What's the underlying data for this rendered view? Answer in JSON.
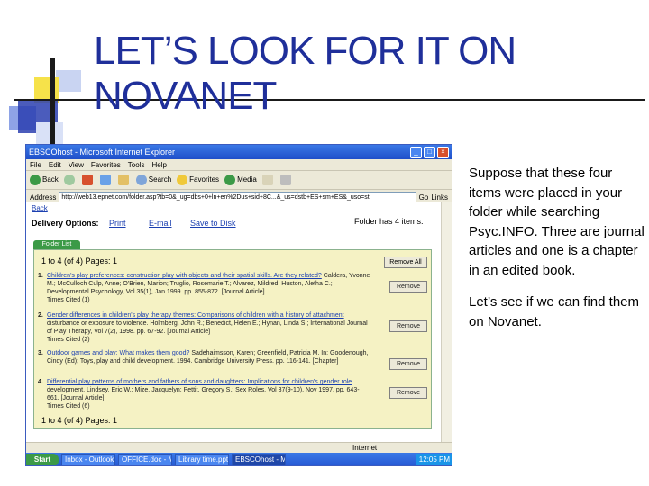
{
  "slide": {
    "title_line1": "LET’S LOOK FOR IT ON",
    "title_line2": "NOVANET",
    "note1": "Suppose that these four items were placed in your folder while searching Psyc.INFO. Three are journal articles and one is a chapter in an edited book.",
    "note2": "Let’s see if we can find them on Novanet."
  },
  "browser": {
    "title": "EBSCOhost - Microsoft Internet Explorer",
    "menu": [
      "File",
      "Edit",
      "View",
      "Favorites",
      "Tools",
      "Help"
    ],
    "toolbar": [
      "Back",
      "Search",
      "Favorites",
      "Media"
    ],
    "address_label": "Address",
    "address_value": "http://web13.epnet.com/folder.asp?tb=0&_ug=dbs+0+ln+en%2Dus+sid+8C...&_us=dstb+ES+sm+ES&_uso=st",
    "go_label": "Go",
    "links_label": "Links",
    "status_zone": "Internet"
  },
  "page": {
    "back_label": "Back",
    "delivery_label": "Delivery Options:",
    "print_label": "Print",
    "email_label": "E-mail",
    "save_label": "Save to Disk",
    "folder_count": "Folder has 4 items.",
    "tab_label": "Folder List",
    "pager_top": "1 to 4 (of 4)   Pages: 1",
    "pager_bottom": "1 to 4 (of 4)   Pages: 1",
    "remove_all": "Remove All",
    "remove": "Remove",
    "items": [
      {
        "num": "1.",
        "title": "Children's play preferences: construction play with objects and their spatial skills. Are they related?",
        "body": "Caldera, Yvonne M.; McCulloch Culp, Anne; O'Brien, Marion; Truglio, Rosemarie T.; Alvarez, Mildred; Huston, Aletha C.; Developmental Psychology, Vol 35(1), Jan 1999. pp. 855-872. [Journal Article]",
        "cited": "Times Cited (1)"
      },
      {
        "num": "2.",
        "title": "Gender differences in children's play therapy themes: Comparisons of children with a history of attachment",
        "body": "disturbance or exposure to violence. Holmberg, John R.; Benedict, Helen E.; Hynan, Linda S.; International Journal of Play Therapy, Vol 7(2), 1998. pp. 67-92. [Journal Article]",
        "cited": "Times Cited (2)"
      },
      {
        "num": "3.",
        "title": "Outdoor games and play: What makes them good?",
        "body": "Sadehaimsson, Karen; Greenfield, Patricia M. In: Goodenough, Cindy (Ed); Toys, play and child development. 1994. Cambridge University Press. pp. 116-141. [Chapter]",
        "cited": ""
      },
      {
        "num": "4.",
        "title": "Differential play patterns of mothers and fathers of sons and daughters: Implications for children's gender role",
        "body": "development. Lindsey, Eric W.; Mize, Jacquelyn; Pettit, Gregory S.; Sex Roles, Vol 37(9-10), Nov 1997. pp. 643-661. [Journal Article]",
        "cited": "Times Cited (6)"
      }
    ]
  },
  "taskbar": {
    "start": "Start",
    "tasks": [
      "Inbox - Outlook Exp...",
      "OFFICE.doc - Micro...",
      "Library time.ppt",
      "EBSCOhost - Micros..."
    ],
    "clock": "12:05 PM"
  }
}
